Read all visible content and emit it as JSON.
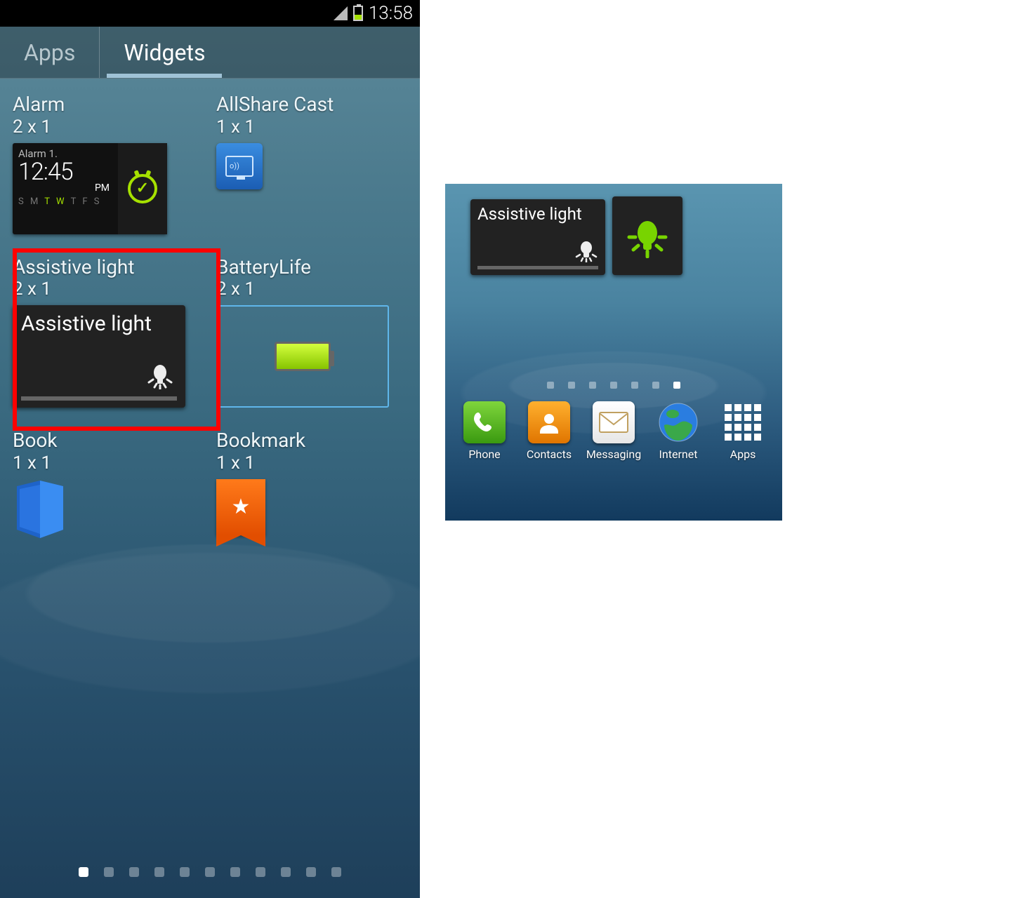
{
  "status": {
    "time": "13:58"
  },
  "tabs": {
    "apps": "Apps",
    "widgets": "Widgets",
    "active": "widgets"
  },
  "widgets": {
    "alarm": {
      "name": "Alarm",
      "size": "2 x 1",
      "preview": {
        "title": "Alarm 1.",
        "time": "12:45",
        "ampm": "PM",
        "days": [
          "S",
          "M",
          "T",
          "W",
          "T",
          "F",
          "S"
        ],
        "active_days": [
          "T",
          "W"
        ]
      }
    },
    "allshare": {
      "name": "AllShare Cast",
      "size": "1 x 1"
    },
    "assistive": {
      "name": "Assistive light",
      "size": "2 x 1",
      "preview_text": "Assistive light"
    },
    "batterylife": {
      "name": "BatteryLife",
      "size": "2 x 1"
    },
    "book": {
      "name": "Book",
      "size": "1 x 1"
    },
    "bookmark": {
      "name": "Bookmark",
      "size": "1 x 1"
    }
  },
  "drawer_pages": {
    "count": 11,
    "active": 0
  },
  "home": {
    "assistive_widget_text": "Assistive light",
    "pages": {
      "count": 7,
      "active": 6
    },
    "dock": {
      "phone": "Phone",
      "contacts": "Contacts",
      "messaging": "Messaging",
      "internet": "Internet",
      "apps": "Apps"
    }
  }
}
